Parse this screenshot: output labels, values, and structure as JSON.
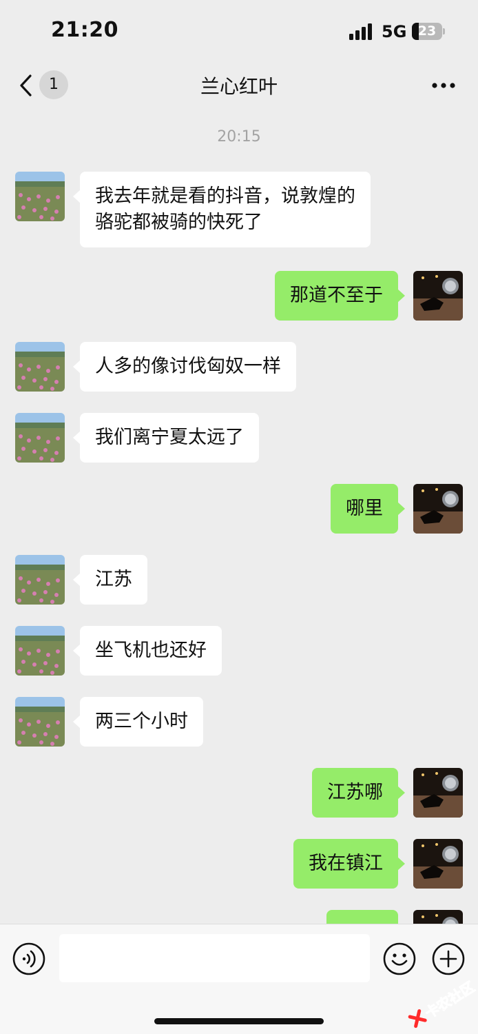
{
  "status_bar": {
    "time": "21:20",
    "network": "5G",
    "battery_level": "23",
    "battery_fraction": 0.23
  },
  "nav": {
    "title": "兰心红叶",
    "unread_count": "1"
  },
  "timestamp": "20:15",
  "messages": [
    {
      "side": "in",
      "text": "我去年就是看的抖音，说敦煌的\n骆驼都被骑的快死了"
    },
    {
      "side": "out",
      "text": "那道不至于"
    },
    {
      "side": "in",
      "text": "人多的像讨伐匈奴一样"
    },
    {
      "side": "in",
      "text": "我们离宁夏太远了"
    },
    {
      "side": "out",
      "text": "哪里"
    },
    {
      "side": "in",
      "text": "江苏"
    },
    {
      "side": "in",
      "text": "坐飞机也还好"
    },
    {
      "side": "in",
      "text": "两三个小时"
    },
    {
      "side": "out",
      "text": "江苏哪"
    },
    {
      "side": "out",
      "text": "我在镇江"
    },
    {
      "side": "out",
      "text": ""
    }
  ],
  "input": {
    "value": ""
  },
  "watermark": {
    "text": "卡农社区"
  },
  "colors": {
    "background": "#ededed",
    "incoming_bubble": "#ffffff",
    "outgoing_bubble": "#95ec69",
    "timestamp": "#a3a3a3"
  },
  "icons": {
    "back": "chevron-left-icon",
    "more": "more-dots-icon",
    "voice": "voice-icon",
    "emoji": "emoji-icon",
    "plus": "plus-icon"
  }
}
